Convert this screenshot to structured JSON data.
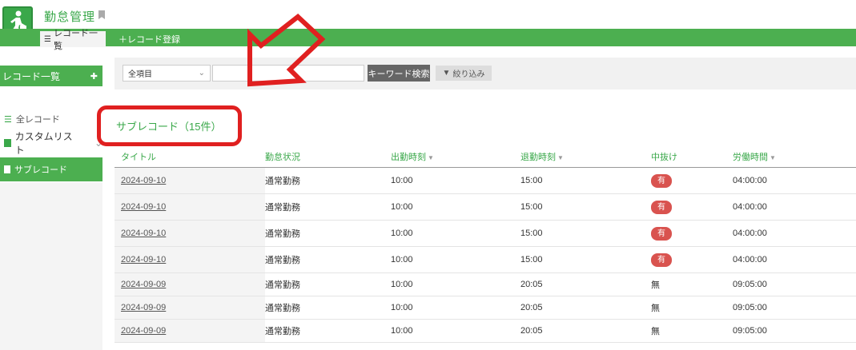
{
  "app": {
    "title": "勤怠管理",
    "icon": "walking-person-icon"
  },
  "tabs": {
    "list_label": "レコード一覧",
    "add_label": "＋レコード登録"
  },
  "sidebar": {
    "header": "レコード一覧",
    "items": [
      {
        "label": "全レコード",
        "icon": "list-icon"
      },
      {
        "label": "カスタムリスト",
        "icon": "folder-icon"
      },
      {
        "label": "サブレコード",
        "icon": "document-icon"
      }
    ]
  },
  "filter": {
    "select_value": "全項目",
    "keyword_value": "",
    "search_label": "キーワード検索",
    "filter_label": "絞り込み"
  },
  "list": {
    "title": "サブレコード（15件）",
    "columns": [
      "タイトル",
      "勤怠状況",
      "出勤時刻",
      "退勤時刻",
      "中抜け",
      "労働時間"
    ],
    "rows": [
      {
        "title": "2024-09-10",
        "status": "通常勤務",
        "start": "10:00",
        "end": "15:00",
        "break": "有",
        "hours": "04:00:00"
      },
      {
        "title": "2024-09-10",
        "status": "通常勤務",
        "start": "10:00",
        "end": "15:00",
        "break": "有",
        "hours": "04:00:00"
      },
      {
        "title": "2024-09-10",
        "status": "通常勤務",
        "start": "10:00",
        "end": "15:00",
        "break": "有",
        "hours": "04:00:00"
      },
      {
        "title": "2024-09-10",
        "status": "通常勤務",
        "start": "10:00",
        "end": "15:00",
        "break": "有",
        "hours": "04:00:00"
      },
      {
        "title": "2024-09-09",
        "status": "通常勤務",
        "start": "10:00",
        "end": "20:05",
        "break": "無",
        "hours": "09:05:00"
      },
      {
        "title": "2024-09-09",
        "status": "通常勤務",
        "start": "10:00",
        "end": "20:05",
        "break": "無",
        "hours": "09:05:00"
      },
      {
        "title": "2024-09-09",
        "status": "通常勤務",
        "start": "10:00",
        "end": "20:05",
        "break": "無",
        "hours": "09:05:00"
      }
    ]
  },
  "colors": {
    "accent": "#4caf50",
    "annotation": "#e02020",
    "badge": "#d9534f"
  }
}
